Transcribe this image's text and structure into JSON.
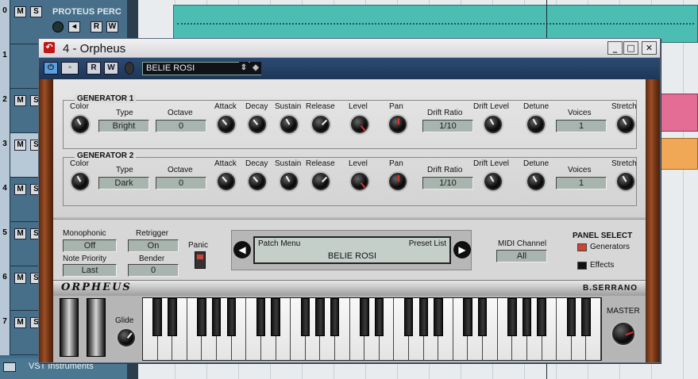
{
  "host": {
    "track_numbers": [
      "0",
      "1",
      "2",
      "3",
      "4",
      "5",
      "6",
      "7"
    ],
    "track0_name": "PROTEUS PERC",
    "mute_label": "M",
    "solo_label": "S",
    "read_label": "R",
    "write_label": "W",
    "vst_folder": "VST Instruments"
  },
  "window": {
    "title": "4 - Orpheus",
    "preset_name": "BELIE ROSI",
    "read_label": "R",
    "write_label": "W",
    "minimize_symbol": "_",
    "maximize_symbol": "□",
    "close_symbol": "✕"
  },
  "generators": [
    {
      "title": "GENERATOR 1",
      "labels": {
        "color": "Color",
        "type": "Type",
        "octave": "Octave",
        "attack": "Attack",
        "decay": "Decay",
        "sustain": "Sustain",
        "release": "Release",
        "level": "Level",
        "pan": "Pan",
        "drift_ratio": "Drift Ratio",
        "drift_level": "Drift Level",
        "detune": "Detune",
        "voices": "Voices",
        "stretch": "Stretch"
      },
      "type_value": "Bright",
      "octave_value": "0",
      "drift_ratio_value": "1/10",
      "voices_value": "1"
    },
    {
      "title": "GENERATOR 2",
      "labels": {
        "color": "Color",
        "type": "Type",
        "octave": "Octave",
        "attack": "Attack",
        "decay": "Decay",
        "sustain": "Sustain",
        "release": "Release",
        "level": "Level",
        "pan": "Pan",
        "drift_ratio": "Drift Ratio",
        "drift_level": "Drift Level",
        "detune": "Detune",
        "voices": "Voices",
        "stretch": "Stretch"
      },
      "type_value": "Dark",
      "octave_value": "0",
      "drift_ratio_value": "1/10",
      "voices_value": "1"
    }
  ],
  "lower": {
    "monophonic_label": "Monophonic",
    "monophonic_value": "Off",
    "retrigger_label": "Retrigger",
    "retrigger_value": "On",
    "note_priority_label": "Note Priority",
    "note_priority_value": "Last",
    "bender_label": "Bender",
    "bender_value": "0",
    "panic_label": "Panic",
    "patch_menu": "Patch Menu",
    "preset_list": "Preset List",
    "display_preset": "BELIE ROSI",
    "midi_channel_label": "MIDI Channel",
    "midi_channel_value": "All",
    "panel_select_title": "PANEL SELECT",
    "generators_label": "Generators",
    "effects_label": "Effects"
  },
  "branding": {
    "logo": "ORPHEUS",
    "maker": "B.SERRANO"
  },
  "keybed": {
    "glide_label": "Glide",
    "master_label": "MASTER",
    "white_keys": 31
  },
  "colors": {
    "host_track": "#476f89",
    "part_teal": "#4bbdb3",
    "part_pink": "#e46d95",
    "part_orange": "#f1a856",
    "toolbar": "#1d3657",
    "lcd": "#a8b4ae"
  }
}
